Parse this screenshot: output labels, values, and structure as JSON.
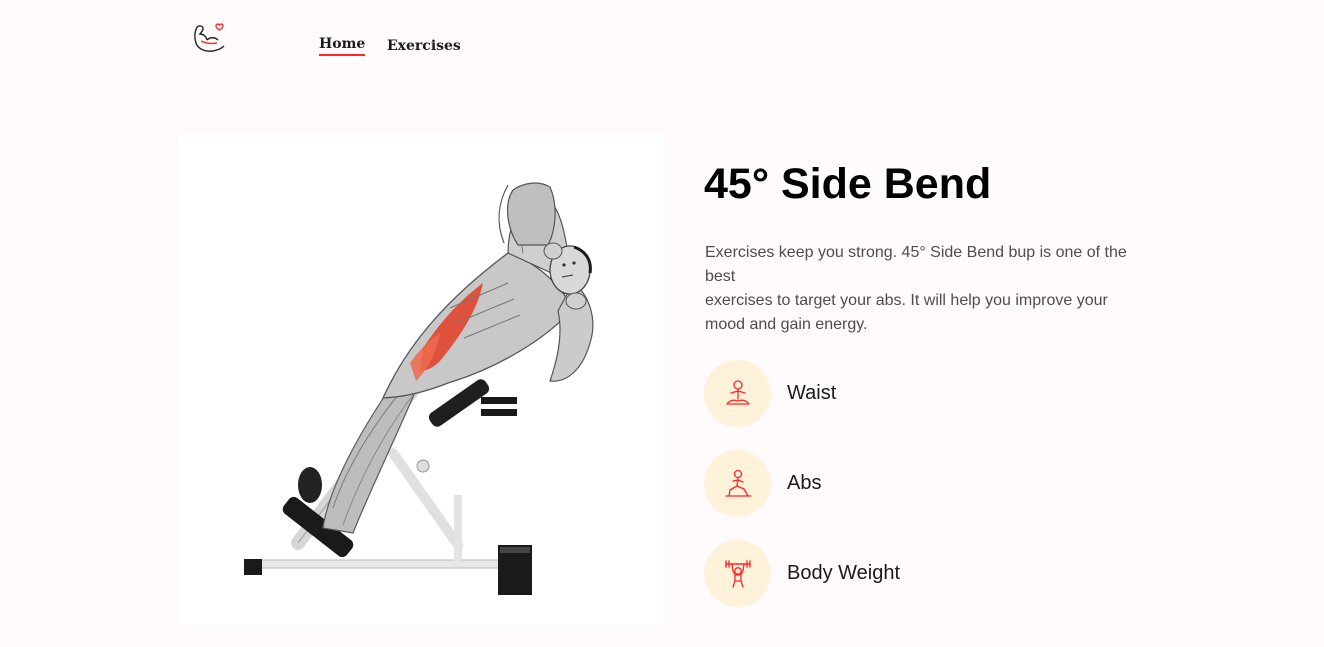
{
  "nav": {
    "logo_icon": "flexed-arm-heart-icon",
    "links": [
      {
        "label": "Home",
        "active": true
      },
      {
        "label": "Exercises",
        "active": false
      }
    ],
    "accent_color": "#ff2625"
  },
  "exercise": {
    "image_icon": "muscle-figure-hyperextension-bench",
    "name": "45° Side Bend",
    "description_lines": [
      "Exercises keep you strong. 45° Side Bend bup is one of the best",
      "exercises to target your abs. It will help you improve your mood and gain energy."
    ],
    "details": [
      {
        "icon": "meditation-figure-icon",
        "label": "Waist"
      },
      {
        "icon": "lunge-figure-icon",
        "label": "Abs"
      },
      {
        "icon": "weightlifter-figure-icon",
        "label": "Body Weight"
      }
    ],
    "detail_icon_bg": "#fff2db"
  }
}
